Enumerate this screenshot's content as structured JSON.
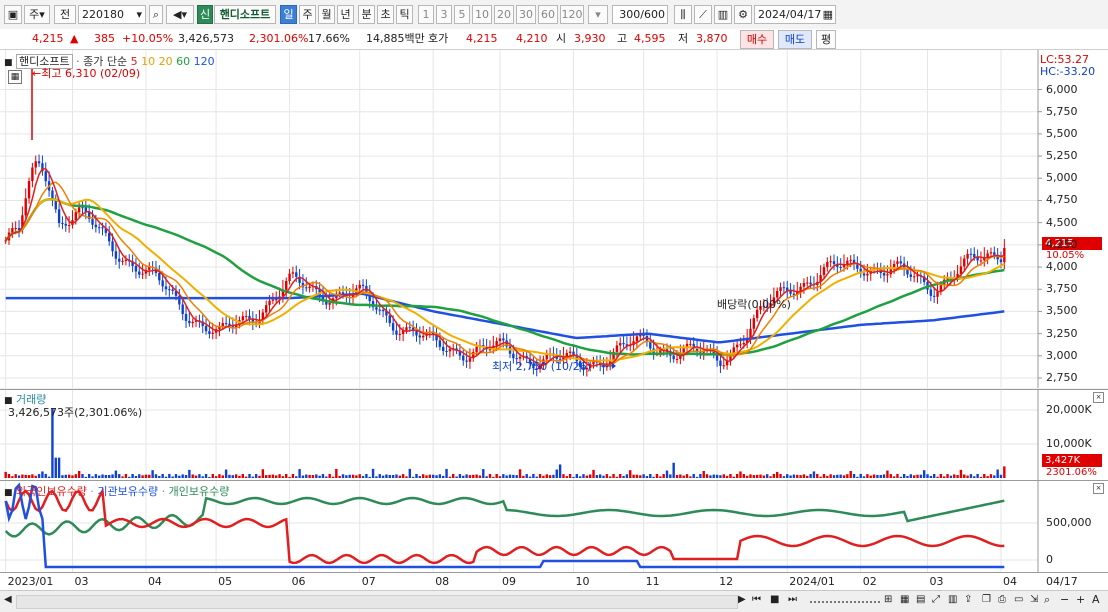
{
  "toolbar": {
    "market": "주",
    "period_type": "전",
    "code": "220180",
    "badge": "신",
    "name": "핸디소프트",
    "periods": [
      "일",
      "주",
      "월",
      "년",
      "분",
      "초",
      "틱"
    ],
    "active_period": "일",
    "minutes": [
      "1",
      "3",
      "5",
      "10",
      "20",
      "30",
      "60",
      "120"
    ],
    "count": "300",
    "count_total": "/600",
    "date": "2024/04/17"
  },
  "quote": {
    "price": "4,215",
    "change": "385",
    "change_pct": "+10.05%",
    "volume": "3,426,573",
    "volume_pct": "2,301.06%",
    "turnover_pct": "17.66%",
    "amount": "14,885백만",
    "ask_label": "호가",
    "ask1": "4,215",
    "ask2": "4,210",
    "open_label": "시",
    "open": "3,930",
    "high_label": "고",
    "high": "4,595",
    "low_label": "저",
    "low": "3,870",
    "buy_label": "매수",
    "sell_label": "매도",
    "avg_label": "평"
  },
  "price_pane": {
    "stock_name": "핸디소프트",
    "ma_label": "종가 단순",
    "ma_periods": [
      "5",
      "10",
      "20",
      "60",
      "120"
    ],
    "ma_colors": [
      "#e02020",
      "#f0b000",
      "#f0b000",
      "#20a040",
      "#2050e0"
    ],
    "high_note": "←최고 6,310 (02/09)",
    "low_note": "최저 2,750 (10/26)",
    "dividend_note": "배당락(0.00%)",
    "lc": "LC:53.27",
    "hc": "HC:-33.20",
    "current_price_tag": "4,215",
    "current_pct_tag": "10.05%",
    "y_ticks": [
      "6,000",
      "5,750",
      "5,500",
      "5,250",
      "5,000",
      "4,750",
      "4,500",
      "4,250",
      "4,000",
      "3,750",
      "3,500",
      "3,250",
      "3,000",
      "2,750"
    ]
  },
  "volume_pane": {
    "title": "거래량",
    "value": "3,426,573주(2,301.06%)",
    "y_ticks": [
      "20,000K",
      "10,000K"
    ],
    "tag_value": "3,427K",
    "tag_pct": "2301.06%"
  },
  "holding_pane": {
    "series": [
      "외국인보유수량",
      "기관보유수량",
      "개인보유수량"
    ],
    "colors": [
      "#e02020",
      "#2050e0",
      "#2e8b57"
    ],
    "y_ticks": [
      "500,000",
      "0"
    ]
  },
  "x_axis": {
    "labels": [
      "2023/01",
      "03",
      "04",
      "05",
      "06",
      "07",
      "08",
      "09",
      "10",
      "11",
      "12",
      "2024/01",
      "02",
      "03",
      "04"
    ],
    "last_label": "04/17"
  },
  "chart_data": {
    "type": "line",
    "title": "핸디소프트",
    "x": [
      "2023/01",
      "03",
      "04",
      "05",
      "06",
      "07",
      "08",
      "09",
      "10",
      "11",
      "12",
      "2024/01",
      "02",
      "03",
      "04"
    ],
    "series": [
      {
        "name": "종가",
        "values": [
          4300,
          4600,
          3900,
          3200,
          3800,
          3650,
          3100,
          3050,
          2900,
          3150,
          2950,
          3800,
          4050,
          3800,
          4215
        ]
      },
      {
        "name": "120",
        "values": [
          3650,
          3650,
          3650,
          3650,
          3650,
          3700,
          3500,
          3350,
          3200,
          3250,
          3150,
          3250,
          3350,
          3400,
          3500
        ]
      }
    ],
    "ylim": [
      2750,
      6310
    ],
    "y_ticks": [
      2750,
      3000,
      3250,
      3500,
      3750,
      4000,
      4250,
      4500,
      4750,
      5000,
      5250,
      5500,
      5750,
      6000
    ]
  }
}
